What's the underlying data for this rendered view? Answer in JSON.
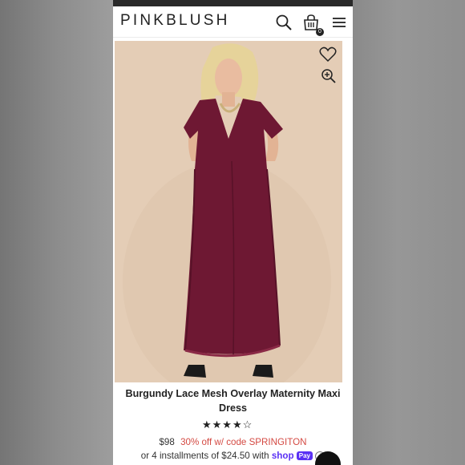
{
  "header": {
    "logo": "PINKBLUSH",
    "cart_count": "0",
    "icons": [
      "search-icon",
      "shopping-bag-icon",
      "hamburger-menu-icon"
    ]
  },
  "product": {
    "title": "Burgundy Lace Mesh Overlay Maternity Maxi Dress",
    "rating_stars": "★★★★☆",
    "rating_value": 4,
    "price": "$98",
    "promo": "30% off w/ code SPRINGITON",
    "installments_prefix": "or 4 installments of $24.50 with",
    "shop_brand": "shop",
    "shop_pay_chip": "Pay",
    "info_glyph": "i"
  },
  "image_actions": {
    "icons": [
      "heart-icon",
      "zoom-in-icon"
    ]
  },
  "colors": {
    "dress": "#6e1833",
    "photo_background": "#e4cdb6",
    "promo_text": "#d44a43",
    "shop_pay": "#5a31f4"
  }
}
